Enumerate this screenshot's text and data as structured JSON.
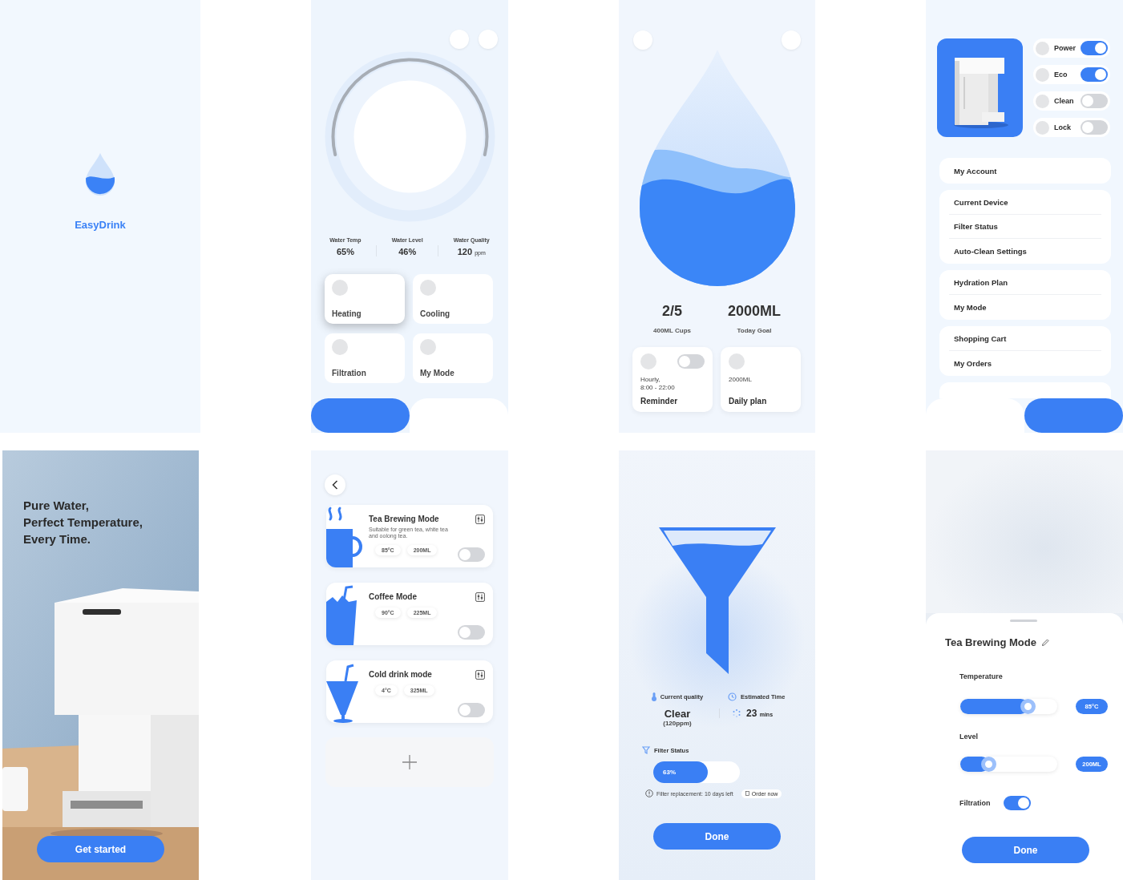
{
  "splash": {
    "app_name": "EasyDrink"
  },
  "home": {
    "stats": [
      {
        "label": "Water Temp",
        "value": "65%"
      },
      {
        "label": "Water Level",
        "value": "46%"
      },
      {
        "label": "Water Quality",
        "value": "120",
        "unit": "ppm"
      }
    ],
    "tiles": [
      {
        "label": "Heating",
        "selected": true
      },
      {
        "label": "Cooling",
        "selected": false
      },
      {
        "label": "Filtration",
        "selected": false
      },
      {
        "label": "My Mode",
        "selected": false
      }
    ],
    "nav": [
      {
        "selected": true
      },
      {
        "selected": false
      }
    ]
  },
  "hydration": {
    "stats": [
      {
        "value": "2/5",
        "label": "400ML Cups"
      },
      {
        "value": "2000ML",
        "label": "Today Goal"
      }
    ],
    "cards": [
      {
        "kind": "reminder",
        "on": false,
        "detail_lines": [
          "Hourly,",
          "8:00 - 22:00"
        ],
        "title": "Reminder"
      },
      {
        "kind": "plan",
        "detail_lines": [
          "2000ML"
        ],
        "title": "Daily plan"
      }
    ]
  },
  "settings": {
    "switches": [
      {
        "label": "Power",
        "on": true
      },
      {
        "label": "Eco",
        "on": true
      },
      {
        "label": "Clean",
        "on": false
      },
      {
        "label": "Lock",
        "on": false
      }
    ],
    "menu_groups": [
      {
        "items": [
          "My Account"
        ]
      },
      {
        "items": [
          "Current Device",
          "Filter Status",
          "Auto-Clean Settings"
        ]
      },
      {
        "items": [
          "Hydration Plan",
          "My Mode"
        ]
      },
      {
        "items": [
          "Shopping Cart",
          "My Orders"
        ]
      }
    ],
    "nav": [
      {
        "selected": false
      },
      {
        "selected": true
      }
    ]
  },
  "welcome": {
    "headline_lines": [
      "Pure Water,",
      "Perfect Temperature,",
      "Every Time."
    ],
    "button": "Get started"
  },
  "modes": {
    "items": [
      {
        "kind": "tea",
        "title": "Tea Brewing Mode",
        "description": "Suitable for green tea, white tea and oolong tea.",
        "temperature": "85°C",
        "volume": "200ML",
        "on": false
      },
      {
        "kind": "coffee",
        "title": "Coffee Mode",
        "temperature": "90°C",
        "volume": "225ML",
        "on": false
      },
      {
        "kind": "cold",
        "title": "Cold drink mode",
        "temperature": "4°C",
        "volume": "325ML",
        "on": false
      }
    ]
  },
  "filter": {
    "quality_label": "Current quality",
    "quality": "Clear",
    "quality_detail": "(120ppm)",
    "time_label": "Estimated Time",
    "time": "23",
    "time_unit": "mins",
    "status_label": "Filter Status",
    "level": 0.63,
    "reading": "63%",
    "note": "Filter replacement: 10 days left",
    "order_button": "Order now",
    "done_button": "Done"
  },
  "editor": {
    "title": "Tea Brewing Mode",
    "sliders": [
      {
        "label": "Temperature",
        "level": 0.7,
        "reading": "85°C"
      },
      {
        "label": "Level",
        "level": 0.3,
        "reading": "200ML"
      }
    ],
    "filtration": {
      "label": "Filtration",
      "on": true
    },
    "done_button": "Done"
  }
}
